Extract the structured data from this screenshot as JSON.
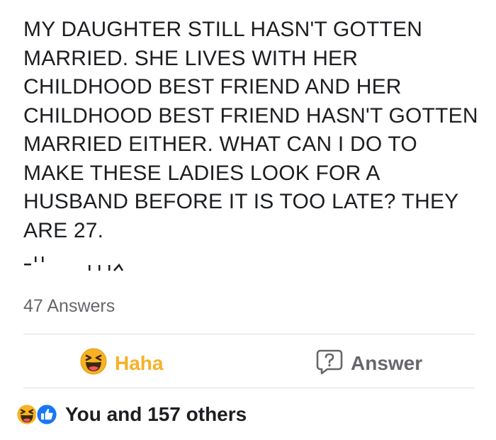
{
  "post": {
    "lines": [
      "MY DAUGHTER STILL HASN'T GOTTEN",
      "MARRIED. SHE LIVES WITH HER",
      "CHILDHOOD BEST FRIEND AND HER",
      "CHILDHOOD BEST FRIEND HASN'T GOTTEN",
      "MARRIED EITHER. WHAT CAN I DO TO",
      "MAKE THESE LADIES LOOK FOR A",
      "HUSBAND BEFORE IT IS TOO LATE? THEY",
      "ARE 27."
    ]
  },
  "answers_count": "47 Answers",
  "actions": {
    "haha_label": "Haha",
    "haha_icon": "laughing-emoji-icon",
    "answer_label": "Answer",
    "answer_icon": "question-bubble-icon"
  },
  "reactions": {
    "text": "You and 157 others",
    "icons": [
      "laughing-emoji-icon",
      "like-thumb-icon"
    ]
  },
  "colors": {
    "text": "#1c1e21",
    "muted": "#65676b",
    "haha": "#f7b125",
    "like": "#1877f2",
    "divider": "#dadde1"
  }
}
